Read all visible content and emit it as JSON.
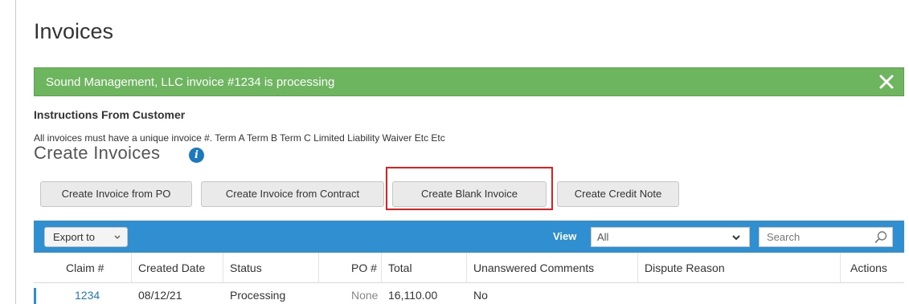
{
  "page": {
    "title": "Invoices"
  },
  "alert": {
    "message": "Sound Management, LLC invoice #1234 is processing",
    "close_icon": "×",
    "color": "#6db55f"
  },
  "instructions": {
    "heading": "Instructions From Customer",
    "text": "All invoices must have a unique invoice #. Term A Term B Term C Limited Liability Waiver Etc Etc"
  },
  "create_section": {
    "title": "Create Invoices",
    "info_icon": "i",
    "buttons": {
      "from_po": "Create Invoice from PO",
      "from_contract": "Create Invoice from Contract",
      "blank": "Create Blank Invoice",
      "credit_note": "Create Credit Note"
    },
    "highlight_color": "#e02020"
  },
  "toolbar": {
    "color": "#2f8fd0",
    "export_label": "Export to",
    "export_chevron": "⌄",
    "view_label": "View",
    "view_value": "All",
    "view_chevron": "❯",
    "search_placeholder": "Search"
  },
  "table": {
    "columns": [
      "Claim #",
      "Created Date",
      "Status",
      "PO #",
      "Total",
      "Unanswered Comments",
      "Dispute Reason",
      "Actions"
    ],
    "rows": [
      {
        "claim": "1234",
        "created_date": "08/12/21",
        "status": "Processing",
        "po": "None",
        "total": "16,110.00",
        "unanswered_comments": "No",
        "dispute_reason": "",
        "actions": ""
      }
    ]
  }
}
